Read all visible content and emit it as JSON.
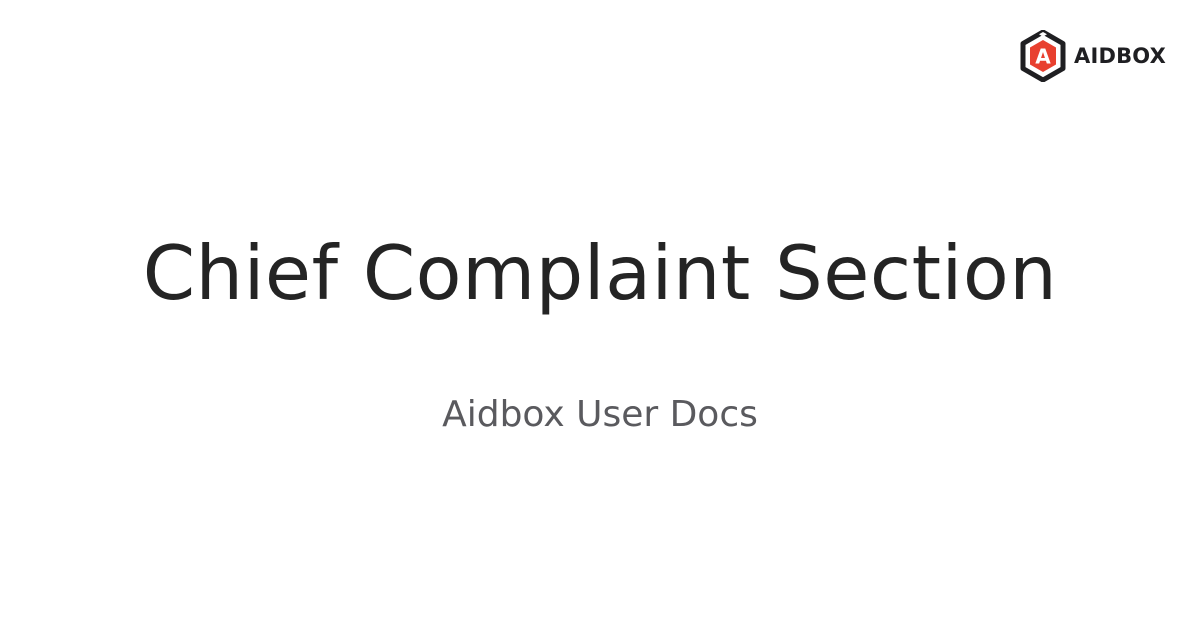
{
  "brand": {
    "name": "AIDBOX",
    "logo_icon": "aidbox-hexagon-logo-icon",
    "logo_letter": "A",
    "colors": {
      "hexagon": "#1f1f22",
      "accent": "#e8402f",
      "text": "#1f1f22"
    }
  },
  "card": {
    "title": "Chief Complaint Section",
    "subtitle": "Aidbox User Docs",
    "colors": {
      "background": "#ffffff",
      "title": "#242424",
      "subtitle": "#5a5a5e"
    }
  }
}
